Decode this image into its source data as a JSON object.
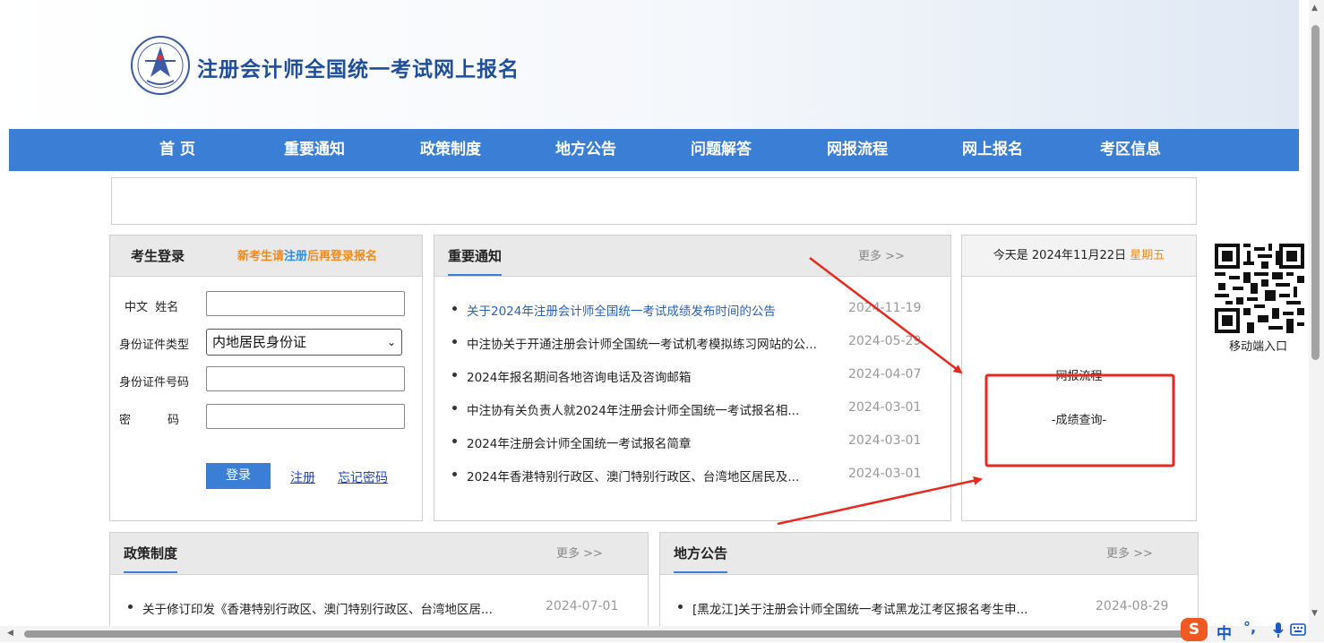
{
  "site": {
    "title": "注册会计师全国统一考试网上报名"
  },
  "nav": [
    {
      "label": "首 页",
      "name": "nav-home"
    },
    {
      "label": "重要通知",
      "name": "nav-notices"
    },
    {
      "label": "政策制度",
      "name": "nav-policy"
    },
    {
      "label": "地方公告",
      "name": "nav-local"
    },
    {
      "label": "问题解答",
      "name": "nav-faq"
    },
    {
      "label": "网报流程",
      "name": "nav-process"
    },
    {
      "label": "网上报名",
      "name": "nav-register-online"
    },
    {
      "label": "考区信息",
      "name": "nav-area-info"
    }
  ],
  "login": {
    "title": "考生登录",
    "hint_prefix": "新考生请",
    "hint_link": "注册",
    "hint_suffix": "后再登录报名",
    "name_label": "中文  姓名",
    "idtype_label": "身份证件类型",
    "idtype_value": "内地居民身份证",
    "idno_label": "身份证件号码",
    "password_label": "密　　码",
    "login_button": "登录",
    "register_link": "注册",
    "forgot_link": "忘记密码"
  },
  "notices": {
    "title": "重要通知",
    "more": "更多 >>",
    "items": [
      {
        "title": "关于2024年注册会计师全国统一考试成绩发布时间的公告",
        "date": "2024-11-19"
      },
      {
        "title": "中注协关于开通注册会计师全国统一考试机考模拟练习网站的公...",
        "date": "2024-05-29"
      },
      {
        "title": "2024年报名期间各地咨询电话及咨询邮箱",
        "date": "2024-04-07"
      },
      {
        "title": "中注协有关负责人就2024年注册会计师全国统一考试报名相...",
        "date": "2024-03-01"
      },
      {
        "title": "2024年注册会计师全国统一考试报名简章",
        "date": "2024-03-01"
      },
      {
        "title": "2024年香港特别行政区、澳门特别行政区、台湾地区居民及...",
        "date": "2024-03-01"
      }
    ]
  },
  "date_panel": {
    "prefix": "今天是 2024年11月22日",
    "weekday": "星期五",
    "process_link": "网报流程",
    "score_link": "-成绩查询-"
  },
  "qr": {
    "label": "移动端入口"
  },
  "policy": {
    "title": "政策制度",
    "more": "更多 >>",
    "items": [
      {
        "title": "关于修订印发《香港特别行政区、澳门特别行政区、台湾地区居...",
        "date": "2024-07-01"
      }
    ]
  },
  "local": {
    "title": "地方公告",
    "more": "更多 >>",
    "items": [
      {
        "title": "[黑龙江]关于注册会计师全国统一考试黑龙江考区报名考生申...",
        "date": "2024-08-29"
      }
    ]
  },
  "ime": {
    "lang": "中",
    "punct": "°,"
  },
  "colors": {
    "nav": "#3a7fd5",
    "accent_orange": "#f08a1c",
    "link_blue": "#2761b8",
    "annotation_red": "#e8271f"
  }
}
